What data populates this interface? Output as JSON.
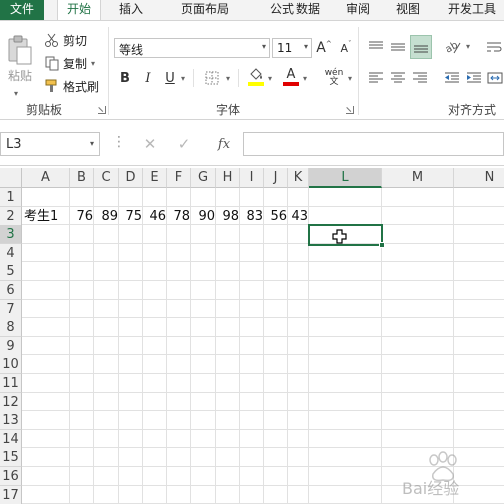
{
  "tabs": [
    {
      "label": "文件"
    },
    {
      "label": "开始"
    },
    {
      "label": "插入"
    },
    {
      "label": "页面布局"
    },
    {
      "label": "公式"
    },
    {
      "label": "数据"
    },
    {
      "label": "审阅"
    },
    {
      "label": "视图"
    },
    {
      "label": "开发工具"
    }
  ],
  "ribbon": {
    "clipboard": {
      "paste_label": "粘贴",
      "cut_label": "剪切",
      "copy_label": "复制",
      "format_painter_label": "格式刷",
      "group_label": "剪贴板"
    },
    "font": {
      "font_name": "等线",
      "font_size": "11",
      "bold": "B",
      "italic": "I",
      "underline": "U",
      "grow_font": "A",
      "shrink_font": "A",
      "font_color_letter": "A",
      "phonetic": "wén",
      "group_label": "字体"
    },
    "alignment": {
      "group_label": "对齐方式"
    },
    "colors": {
      "accent": "#217346",
      "highlight": "#ffff00",
      "font_color": "#ff0000"
    }
  },
  "formula_bar": {
    "name_box": "L3",
    "formula": "",
    "fx_label": "fx"
  },
  "grid": {
    "columns": [
      "A",
      "B",
      "C",
      "D",
      "E",
      "F",
      "G",
      "H",
      "I",
      "J",
      "K",
      "L",
      "M",
      "N"
    ],
    "rows": [
      "1",
      "2",
      "3",
      "4",
      "5",
      "6",
      "7",
      "8",
      "9",
      "10",
      "11",
      "12",
      "13",
      "14",
      "15",
      "16",
      "17"
    ],
    "selected_column": "L",
    "selected_row": "3",
    "row2": {
      "A": "考生1",
      "B": "76",
      "C": "89",
      "D": "75",
      "E": "46",
      "F": "78",
      "G": "90",
      "H": "98",
      "I": "83",
      "J": "56",
      "K": "43"
    }
  },
  "watermark": {
    "text": "Bai经验"
  }
}
